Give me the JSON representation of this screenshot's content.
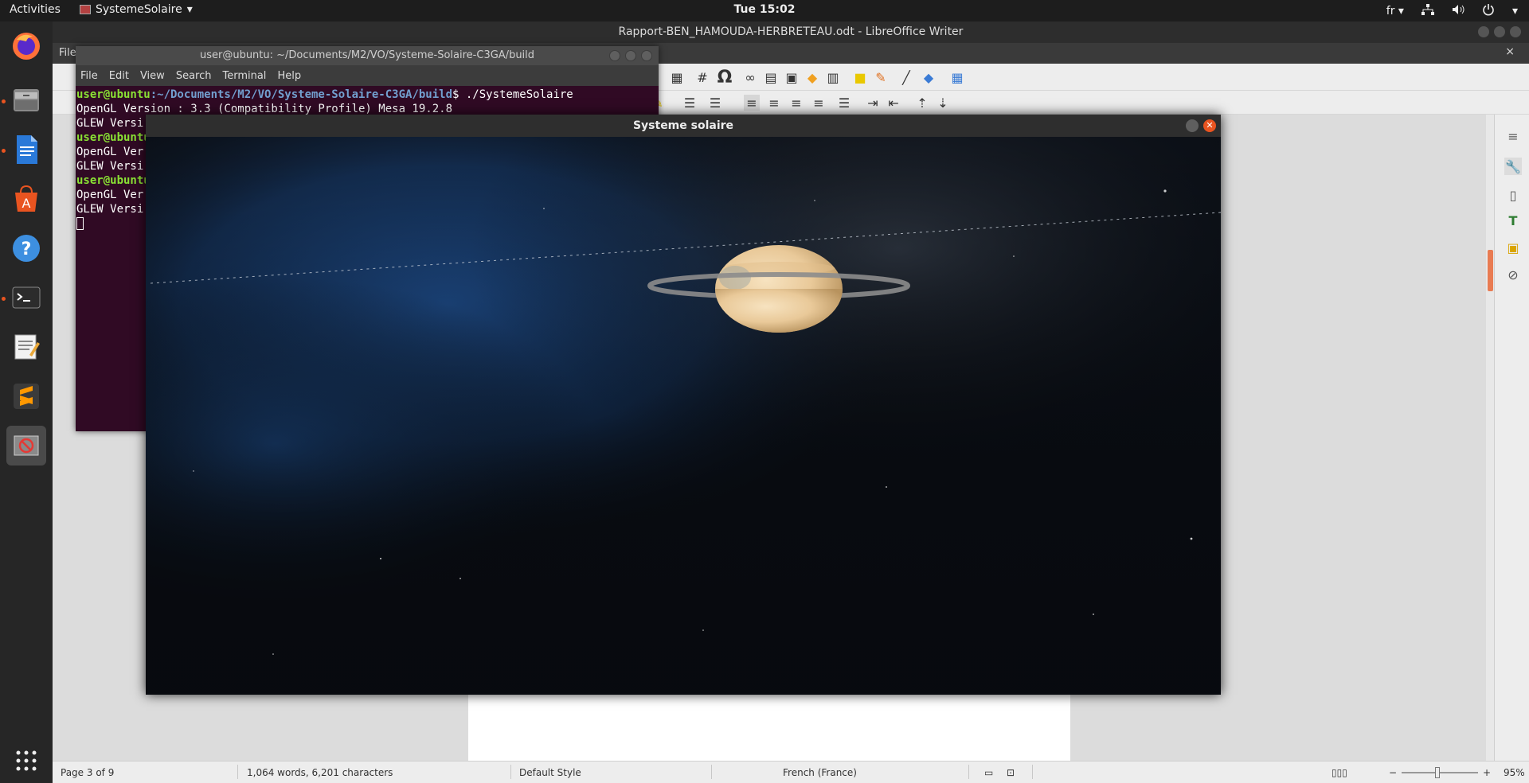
{
  "topbar": {
    "activities": "Activities",
    "app_name": "SystemeSolaire",
    "clock": "Tue 15:02",
    "lang": "fr"
  },
  "writer": {
    "title": "Rapport-BEN_HAMOUDA-HERBRETEAU.odt - LibreOffice Writer",
    "file_menu": "File",
    "status": {
      "page": "Page 3 of 9",
      "words": "1,064 words, 6,201 characters",
      "style": "Default Style",
      "language": "French (France)",
      "zoom": "95%"
    }
  },
  "terminal": {
    "title": "user@ubuntu: ~/Documents/M2/VO/Systeme-Solaire-C3GA/build",
    "menu": [
      "File",
      "Edit",
      "View",
      "Search",
      "Terminal",
      "Help"
    ],
    "prompt_user": "user@ubuntu",
    "prompt_path": ":~/Documents/M2/VO/Systeme-Solaire-C3GA/build",
    "command": "$ ./SystemeSolaire",
    "line_opengl": "OpenGL Version : 3.3 (Compatibility Profile) Mesa 19.2.8",
    "line_glew": "GLEW Versi",
    "line_user_short": "user@ubuntu",
    "line_opengl_short": "OpenGL Ver",
    "line_glew_short": "GLEW Versi"
  },
  "glwindow": {
    "title": "Systeme solaire"
  },
  "dock": {
    "items": [
      "firefox-icon",
      "files-icon",
      "writer-icon",
      "software-icon",
      "help-icon",
      "terminal-icon",
      "text-editor-icon",
      "sublime-icon",
      "systemesolaire-icon",
      "app-grid-icon"
    ]
  },
  "colors": {
    "accent": "#e95420",
    "terminal_bg": "#300a24",
    "prompt_green": "#8ae234",
    "prompt_blue": "#729fcf"
  }
}
